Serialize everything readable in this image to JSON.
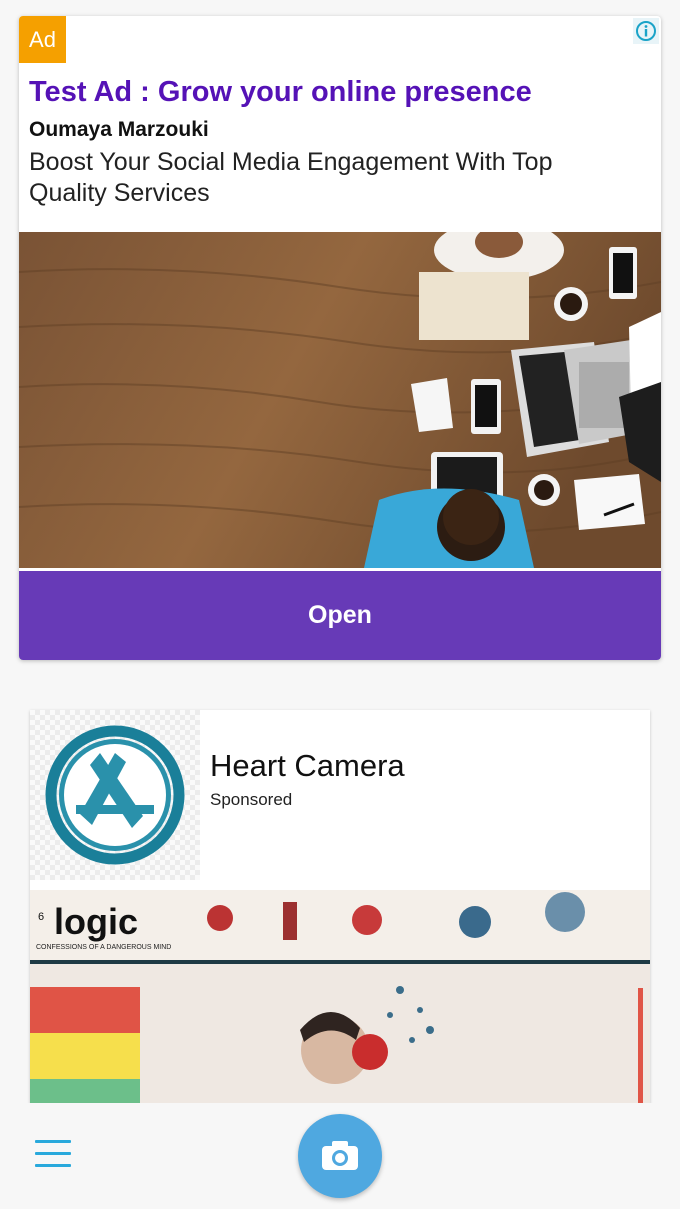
{
  "ad": {
    "badge": "Ad",
    "title": "Test Ad : Grow your online presence",
    "advertiser": "Oumaya Marzouki",
    "body": "Boost Your Social Media Engagement With Top Quality Services",
    "cta": "Open",
    "image_alt": "office desk with laptop, phones, coffee and people"
  },
  "native": {
    "title": "Heart Camera",
    "sponsored": "Sponsored",
    "app_icon": "app-store-icon",
    "image": {
      "logo_text": "logic",
      "tagline": "CONFESSIONS OF A DANGEROUS MIND",
      "side_number": "6"
    }
  },
  "bottom": {
    "menu_icon": "hamburger-icon",
    "camera_icon": "camera-icon"
  },
  "colors": {
    "ad_badge": "#f5a000",
    "ad_title": "#5512b6",
    "cta": "#673ab7",
    "camera": "#4fa8e0",
    "menu": "#29a9dc"
  }
}
